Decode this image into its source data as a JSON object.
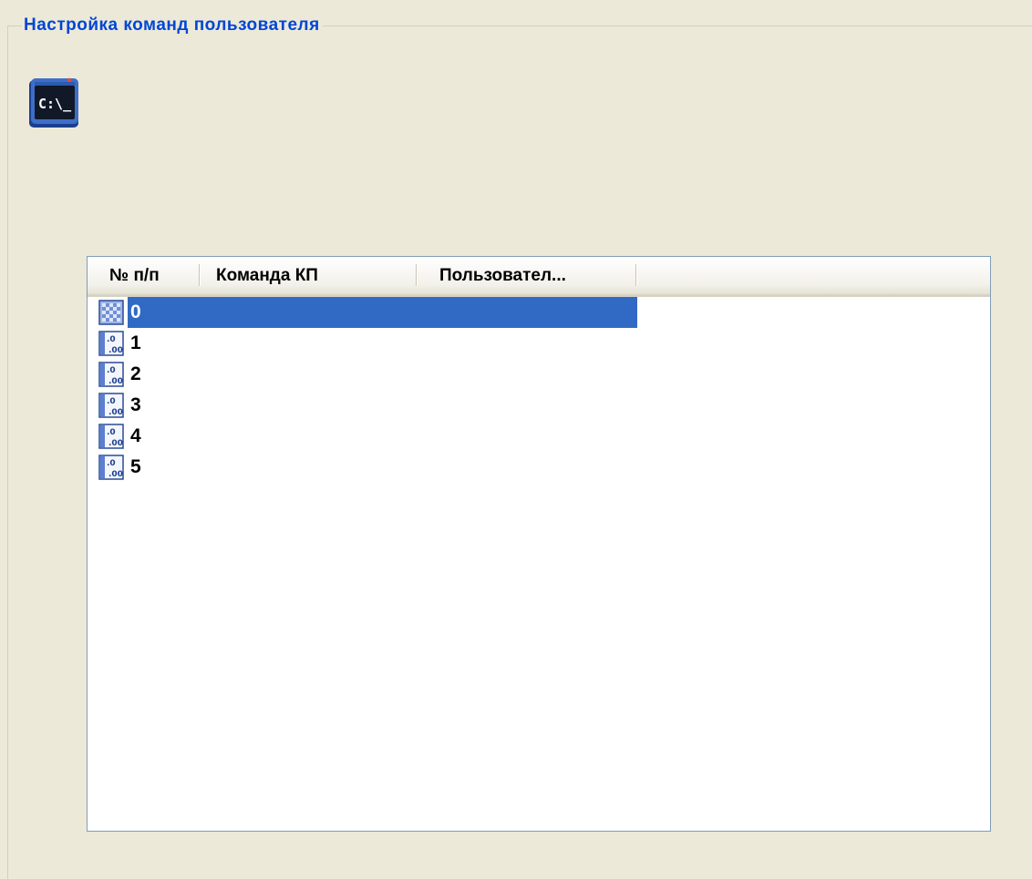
{
  "group": {
    "title": "Настройка команд пользователя",
    "icon": "command-prompt-icon",
    "icon_text": "C:\\_"
  },
  "list": {
    "columns": [
      "№ п/п",
      "Команда КП",
      "Пользовател..."
    ],
    "selected_index": 0,
    "rows": [
      {
        "label": "0",
        "icon": "numeric-value-icon"
      },
      {
        "label": "1",
        "icon": "numeric-value-icon"
      },
      {
        "label": "2",
        "icon": "numeric-value-icon"
      },
      {
        "label": "3",
        "icon": "numeric-value-icon"
      },
      {
        "label": "4",
        "icon": "numeric-value-icon"
      },
      {
        "label": "5",
        "icon": "numeric-value-icon"
      }
    ]
  },
  "colors": {
    "accent": "#0046D5",
    "selection": "#316AC5",
    "window_bg": "#ECE9D8",
    "list_border": "#7F9DB9"
  }
}
